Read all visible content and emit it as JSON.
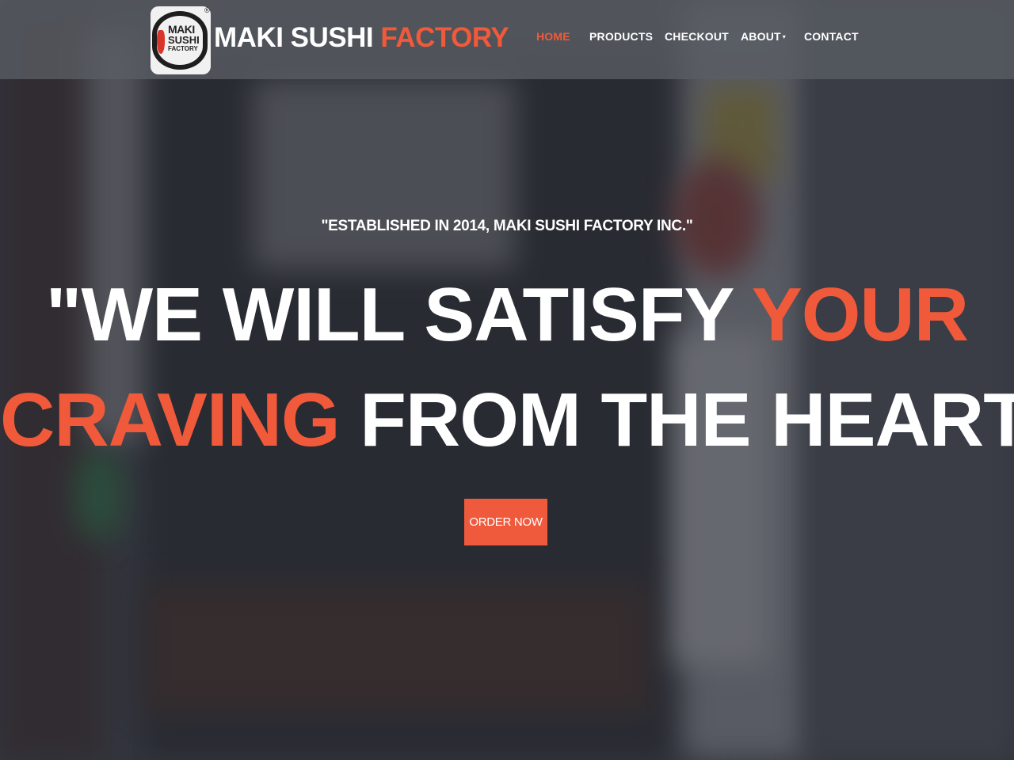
{
  "brand": {
    "logo_line1": "MAKI",
    "logo_line2": "SUSHI",
    "logo_line3": "FACTORY",
    "logo_reg": "®",
    "name_white": "MAKI SUSHI",
    "name_orange": "FACTORY"
  },
  "nav": {
    "items": [
      {
        "label": "HOME",
        "active": true
      },
      {
        "label": "PRODUCTS",
        "active": false
      },
      {
        "label": "CHECKOUT",
        "active": false
      },
      {
        "label": "ABOUT",
        "active": false,
        "has_dropdown": true,
        "caret": "▾"
      },
      {
        "label": "CONTACT",
        "active": false
      }
    ]
  },
  "hero": {
    "tagline": "\"ESTABLISHED IN 2014, MAKI SUSHI FACTORY INC.\"",
    "line1_white": "\"WE WILL SATISFY ",
    "line1_orange": "YOUR",
    "line2_orange": "CRAVING",
    "line2_white": " FROM THE HEART\"",
    "cta_label": "ORDER NOW"
  },
  "colors": {
    "accent": "#f05a3a",
    "text": "#ffffff",
    "header_bg": "#5a5d64"
  }
}
